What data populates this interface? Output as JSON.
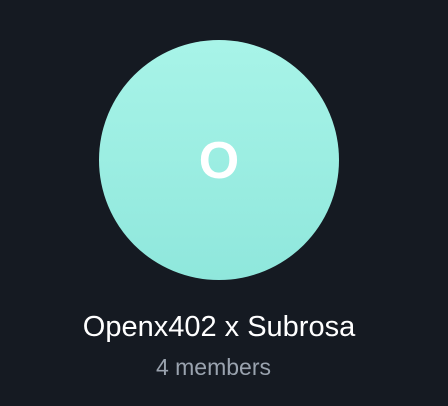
{
  "group": {
    "avatar_initial": "O",
    "name": "Openx402 x Subrosa",
    "member_count": "4 members"
  },
  "colors": {
    "background": "#151a22",
    "avatar_top": "#a8f4e8",
    "avatar_bottom": "#8fe7dc",
    "name_text": "#ffffff",
    "subtitle_text": "#9aa3af"
  }
}
